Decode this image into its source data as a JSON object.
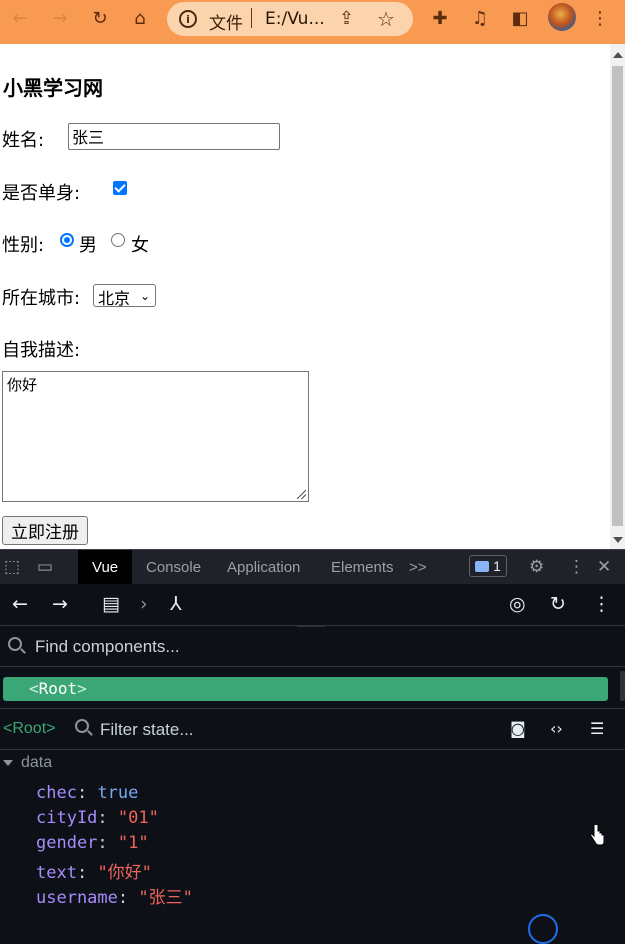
{
  "browser": {
    "scheme_label": "文件",
    "url": "E:/Vu..."
  },
  "page": {
    "title": "小黑学习网",
    "name_label": "姓名:",
    "name_value": "张三",
    "single_label": "是否单身:",
    "single_checked": true,
    "gender_label": "性别:",
    "gender_options": [
      "男",
      "女"
    ],
    "gender_selected": "男",
    "city_label": "所在城市:",
    "city_selected": "北京",
    "desc_label": "自我描述:",
    "desc_value": "你好",
    "submit_label": "立即注册"
  },
  "devtools": {
    "tabs": [
      "Vue",
      "Console",
      "Application",
      "Elements"
    ],
    "active_tab": "Vue",
    "more_label": ">>",
    "issues_count": "1"
  },
  "vue": {
    "find_placeholder": "Find components...",
    "root_label": "Root",
    "selected_component": "<Root>",
    "filter_placeholder": "Filter state...",
    "section": "data",
    "state": [
      {
        "key": "chec",
        "value": "true",
        "kind": "bool"
      },
      {
        "key": "cityId",
        "value": "\"01\"",
        "kind": "string"
      },
      {
        "key": "gender",
        "value": "\"1\"",
        "kind": "string"
      },
      {
        "key": "text",
        "value": "\"你好\"",
        "kind": "string"
      },
      {
        "key": "username",
        "value": "\"张三\"",
        "kind": "string"
      }
    ]
  },
  "colors": {
    "toolbar": "#f89a52",
    "vue_green": "#3ba776",
    "checkbox_blue": "#0075ff"
  }
}
